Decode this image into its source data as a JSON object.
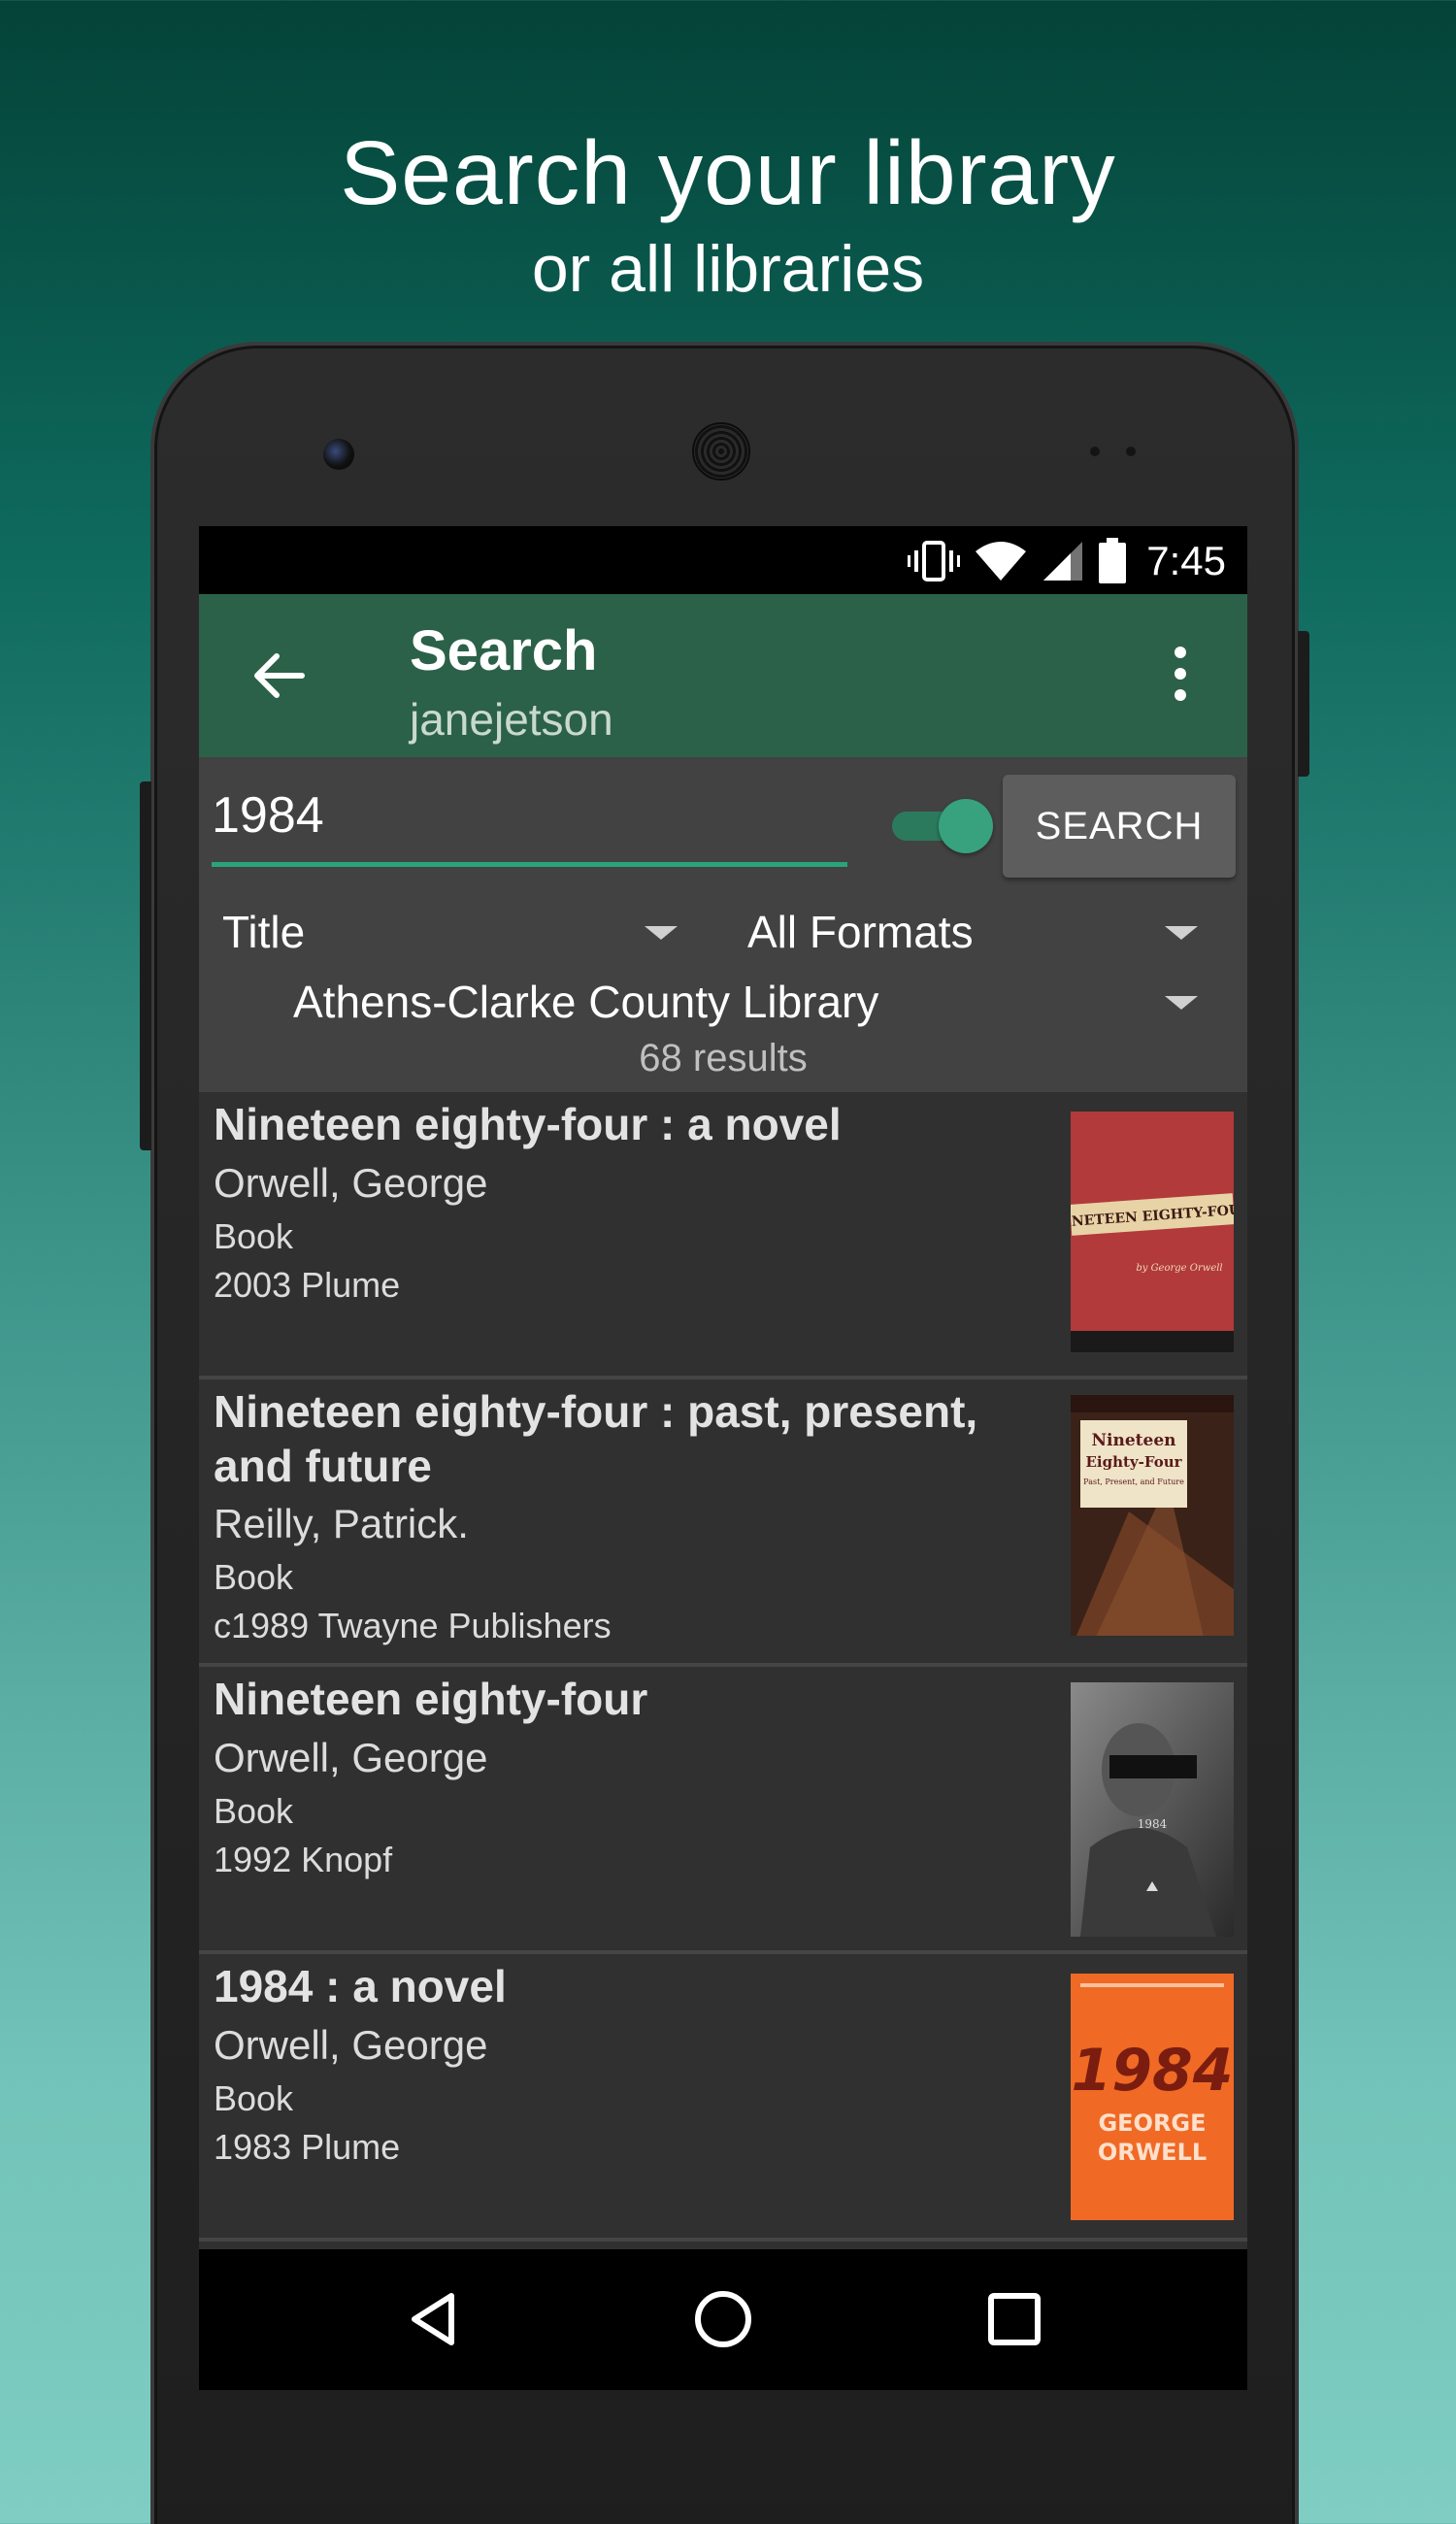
{
  "promo": {
    "headline": "Search your library",
    "subheadline": "or all libraries"
  },
  "status_bar": {
    "time": "7:45",
    "icons": [
      "vibrate-icon",
      "wifi-icon",
      "signal-icon",
      "battery-icon"
    ]
  },
  "app_bar": {
    "title": "Search",
    "subtitle": "janejetson",
    "icons": [
      "back-arrow-icon",
      "overflow-menu-icon"
    ]
  },
  "search": {
    "query": "1984",
    "toggle_on": true,
    "button_label": "SEARCH",
    "search_by": "Title",
    "format": "All Formats",
    "library": "Athens-Clarke County Library",
    "results_count": "68 results"
  },
  "results": [
    {
      "title": "Nineteen eighty-four : a novel",
      "author": "Orwell, George",
      "format": "Book",
      "pub": "2003 Plume",
      "cover": {
        "bg": "#b23a3a",
        "text": "NINETEEN EIGHTY-FOUR",
        "byline": "by George Orwell"
      }
    },
    {
      "title": "Nineteen eighty-four : past, present, and future",
      "author": "Reilly, Patrick.",
      "format": "Book",
      "pub": "c1989 Twayne Publishers",
      "cover": {
        "bg": "#4a2c20",
        "text": "Nineteen Eighty-Four",
        "byline": "Past, Present, and Future"
      }
    },
    {
      "title": "Nineteen eighty-four",
      "author": "Orwell, George",
      "format": "Book",
      "pub": "1992 Knopf",
      "cover": {
        "bg": "#4a4a4a",
        "text": "1984",
        "byline": ""
      }
    },
    {
      "title": "1984 : a novel",
      "author": "Orwell, George",
      "format": "Book",
      "pub": "1983 Plume",
      "cover": {
        "bg": "#f06a25",
        "text": "1984",
        "byline": "GEORGE ORWELL"
      }
    }
  ],
  "nav_bar": {
    "icons": [
      "nav-back-icon",
      "nav-home-icon",
      "nav-recents-icon"
    ]
  },
  "colors": {
    "app_bar": "#2b6148",
    "accent": "#2aa37d",
    "list_bg": "#303030",
    "search_bg": "#424242"
  }
}
